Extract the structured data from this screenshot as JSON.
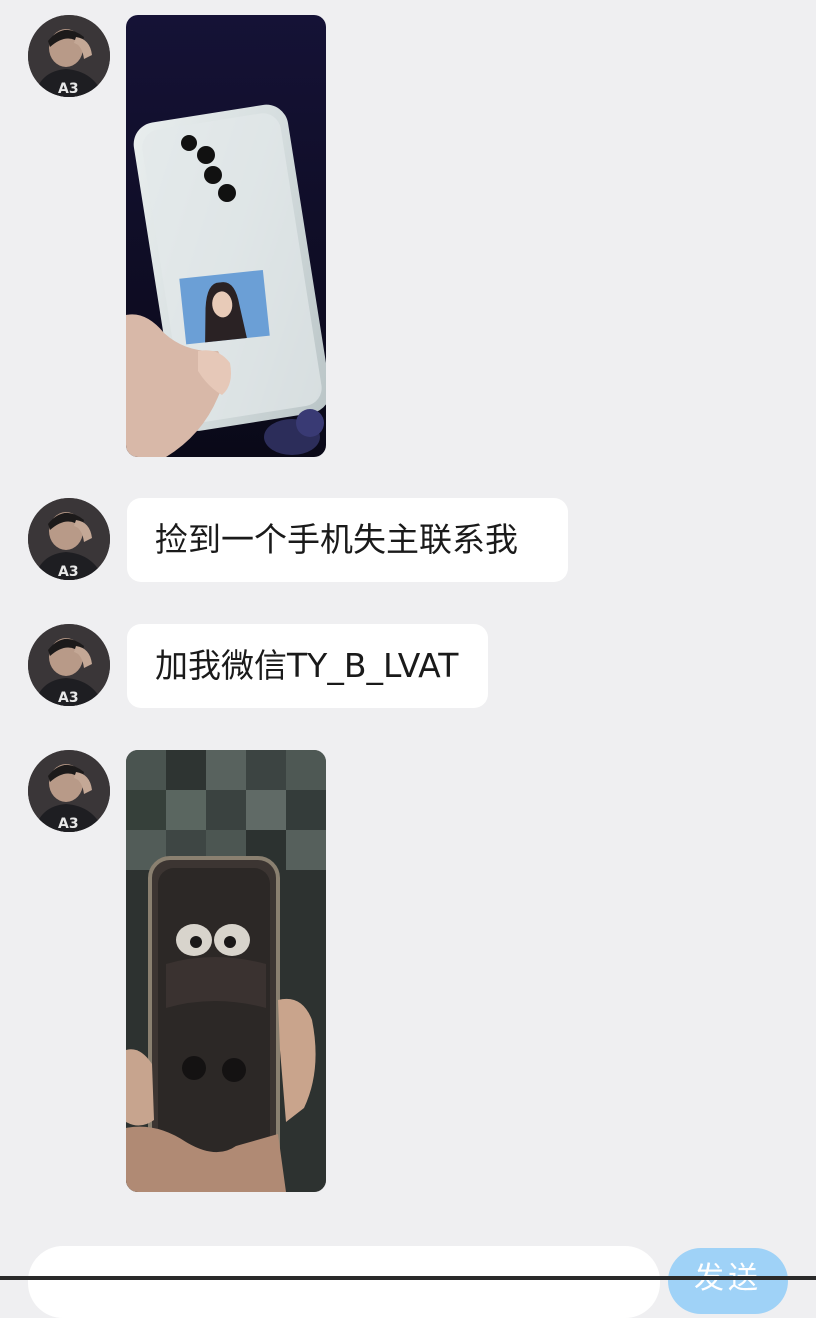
{
  "messages": [
    {
      "type": "image",
      "content": "photo of a phone with a transparent case and an ID photo inside"
    },
    {
      "type": "text",
      "text": "捡到一个手机失主联系我"
    },
    {
      "type": "text",
      "text": "加我微信TY_B_LVAT"
    },
    {
      "type": "image",
      "content": "photo of a phone with a dark cartoon-face case held in a hand"
    }
  ],
  "composer": {
    "input_value": "",
    "send_label": "发送"
  },
  "colors": {
    "background": "#efeff1",
    "bubble": "#ffffff",
    "send_button": "#9fd2f7",
    "text": "#1a1a1a"
  }
}
